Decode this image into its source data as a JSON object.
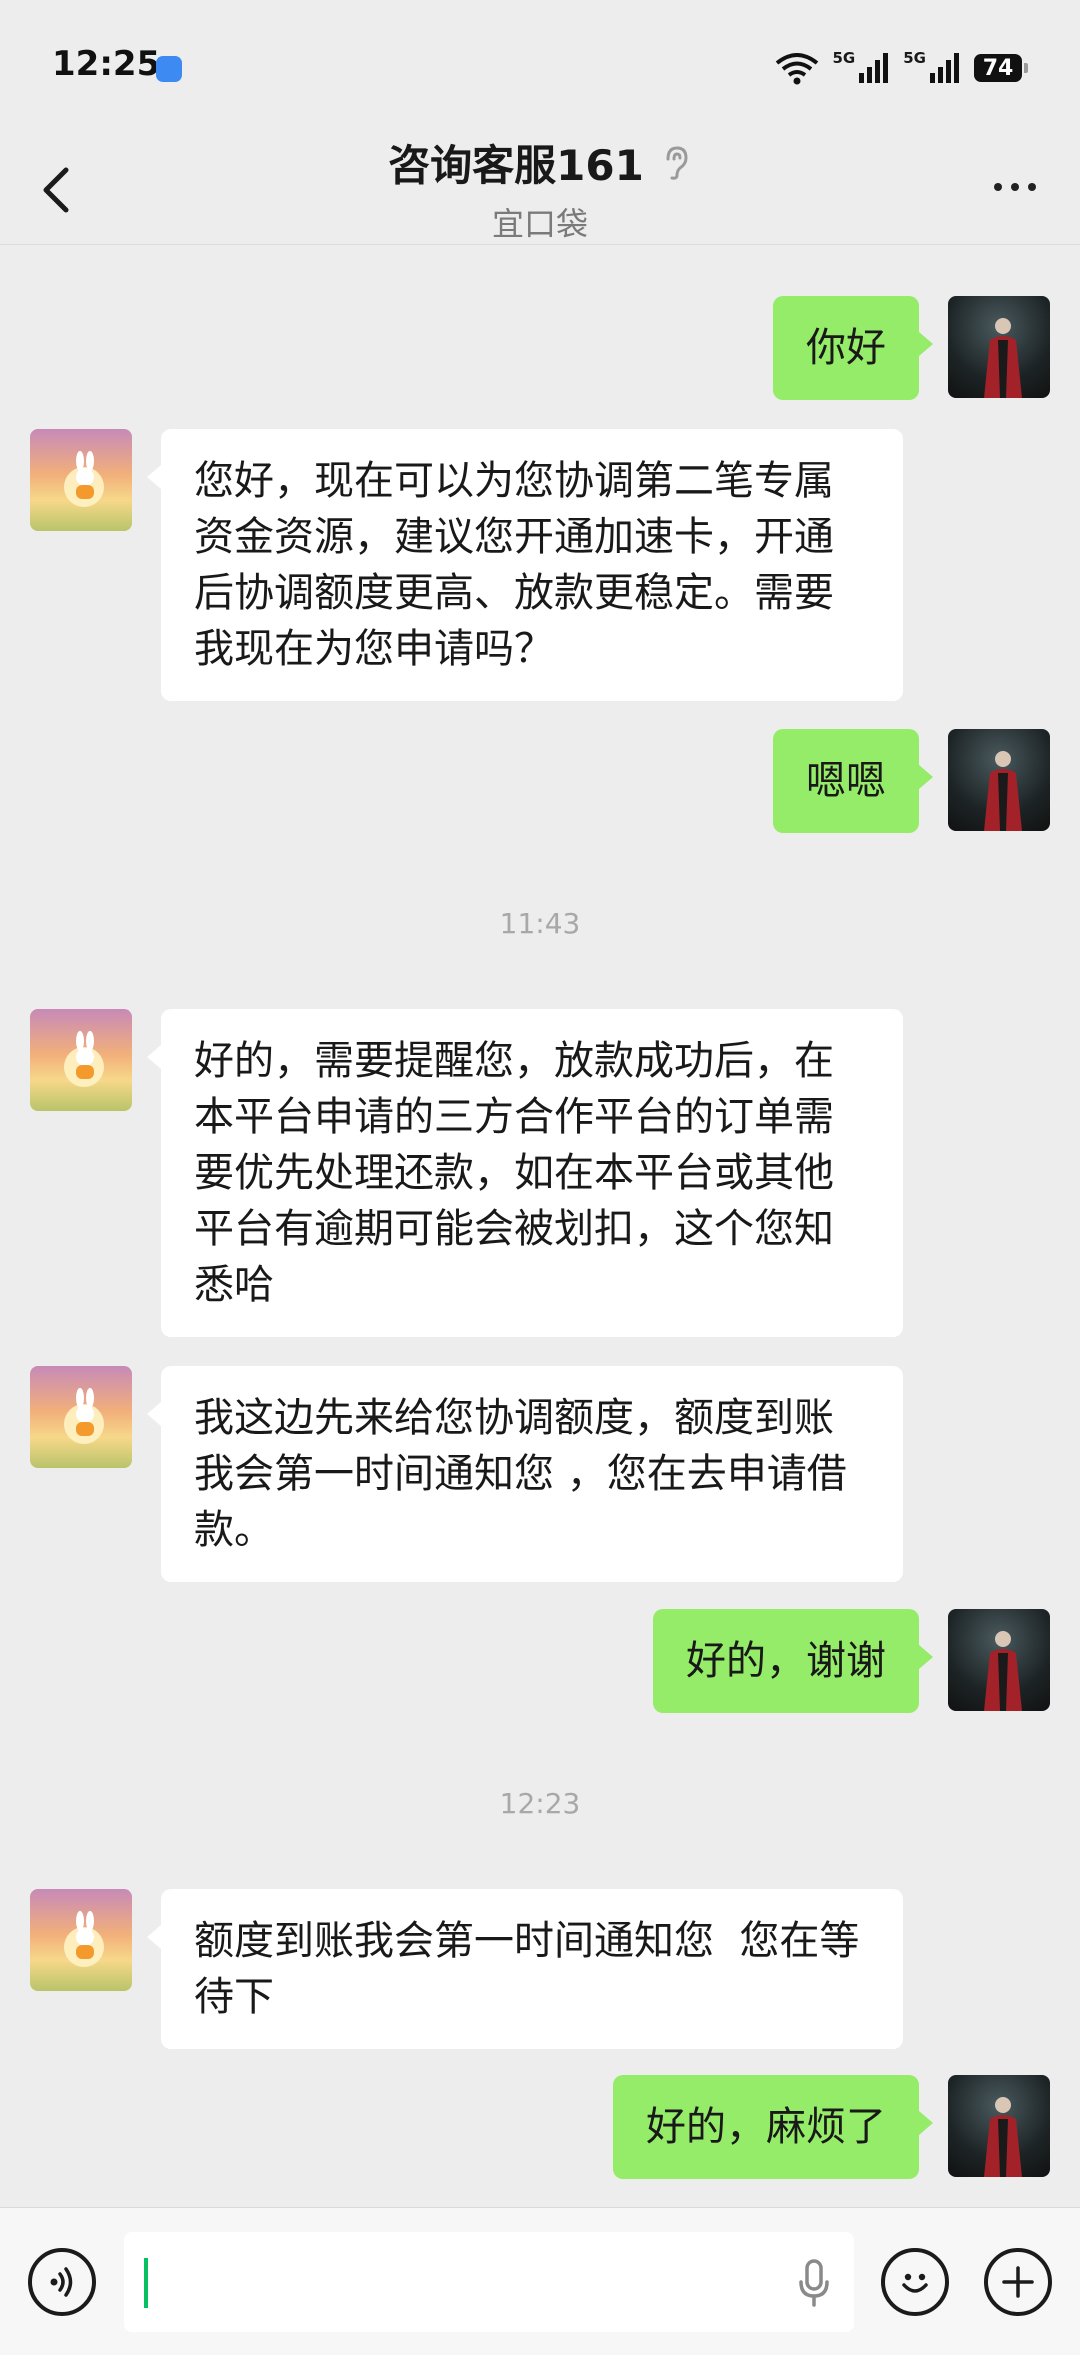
{
  "status_bar": {
    "time": "12:25",
    "signal_1": "5G",
    "signal_2": "5G",
    "battery": "74"
  },
  "header": {
    "title": "咨询客服161",
    "subtitle": "宜口袋",
    "back_icon": "chevron-left-icon",
    "more_icon": "more-dots-icon",
    "ear_icon": "ear-icon"
  },
  "messages": [
    {
      "from": "me",
      "text": "你好"
    },
    {
      "from": "agent",
      "text": "您好，现在可以为您协调第二笔专属资金资源，建议您开通加速卡，开通后协调额度更高、放款更稳定。需要我现在为您申请吗？"
    },
    {
      "from": "me",
      "text": "嗯嗯"
    },
    {
      "type": "time",
      "text": "11:43"
    },
    {
      "from": "agent",
      "text": "好的，需要提醒您，放款成功后，在本平台申请的三方合作平台的订单需要优先处理还款，如在本平台或其他平台有逾期可能会被划扣，这个您知悉哈"
    },
    {
      "from": "agent",
      "text": "我这边先来给您协调额度，额度到账我会第一时间通知您 ，您在去申请借款。"
    },
    {
      "from": "me",
      "text": "好的，谢谢"
    },
    {
      "type": "time",
      "text": "12:23"
    },
    {
      "from": "agent",
      "text": "额度到账我会第一时间通知您  您在等待下"
    },
    {
      "from": "me",
      "text": "好的，麻烦了"
    }
  ],
  "input_bar": {
    "voice_icon": "voice-icon",
    "mic_icon": "mic-icon",
    "emoji_icon": "emoji-icon",
    "plus_icon": "plus-icon",
    "value": ""
  },
  "colors": {
    "background": "#ededed",
    "outgoing_bubble": "#95ec69",
    "incoming_bubble": "#ffffff",
    "cursor": "#07c160"
  }
}
